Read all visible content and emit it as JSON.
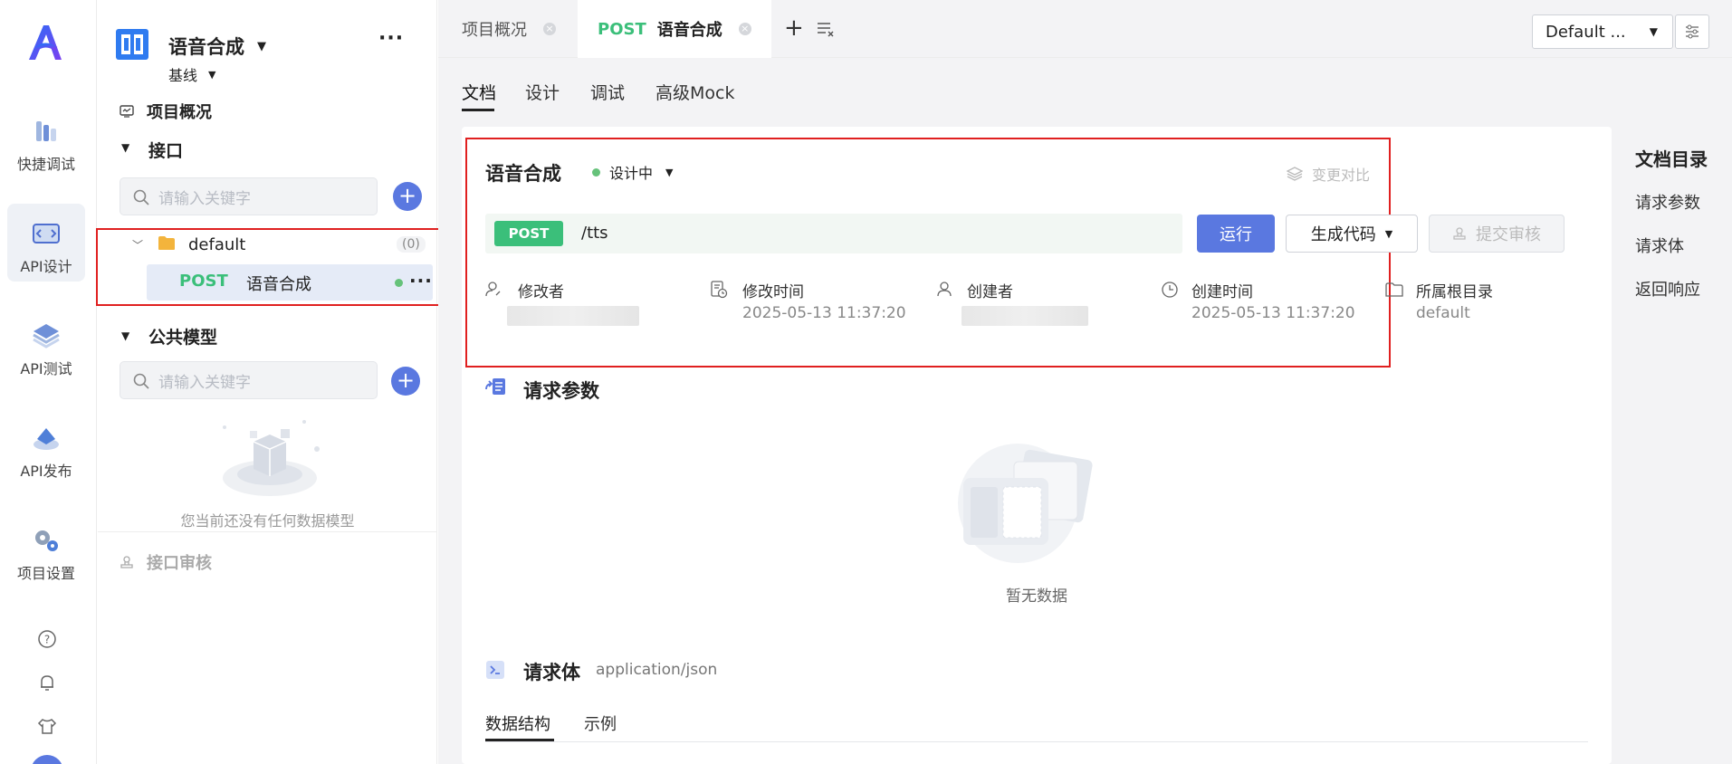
{
  "rail": {
    "items": [
      {
        "label": "快捷调试"
      },
      {
        "label": "API设计"
      },
      {
        "label": "API测试"
      },
      {
        "label": "API发布"
      },
      {
        "label": "项目设置"
      }
    ]
  },
  "sidebar": {
    "project_name": "语音合成",
    "branch": "基线",
    "overview_label": "项目概况",
    "interfaces_label": "接口",
    "search_placeholder": "请输入关键字",
    "folder_name": "default",
    "folder_count": "(0)",
    "endpoint": {
      "method": "POST",
      "name": "语音合成"
    },
    "models_label": "公共模型",
    "models_search_placeholder": "请输入关键字",
    "empty_models_text": "您当前还没有任何数据模型",
    "review_label": "接口审核"
  },
  "tabs": [
    {
      "label": "项目概况"
    },
    {
      "method": "POST",
      "label": "语音合成"
    }
  ],
  "env": {
    "selected": "Default ..."
  },
  "subtabs": [
    "文档",
    "设计",
    "调试",
    "高级Mock"
  ],
  "doc": {
    "title": "语音合成",
    "status": "设计中",
    "compare_label": "变更对比",
    "method": "POST",
    "path": "/tts",
    "run_label": "运行",
    "gen_code_label": "生成代码",
    "submit_review_label": "提交审核",
    "meta": {
      "modifier_label": "修改者",
      "modified_time_label": "修改时间",
      "modified_time": "2025-05-13 11:37:20",
      "creator_label": "创建者",
      "created_time_label": "创建时间",
      "created_time": "2025-05-13 11:37:20",
      "root_dir_label": "所属根目录",
      "root_dir": "default"
    },
    "request_params_title": "请求参数",
    "empty_text": "暂无数据",
    "request_body_title": "请求体",
    "request_body_type": "application/json",
    "body_tabs": [
      "数据结构",
      "示例"
    ]
  },
  "toc": {
    "title": "文档目录",
    "items": [
      "请求参数",
      "请求体",
      "返回响应"
    ]
  },
  "colors": {
    "accent": "#5a78e0",
    "post_green": "#3bbf7a",
    "status_green": "#66c27a",
    "highlight_red": "#e02020"
  }
}
